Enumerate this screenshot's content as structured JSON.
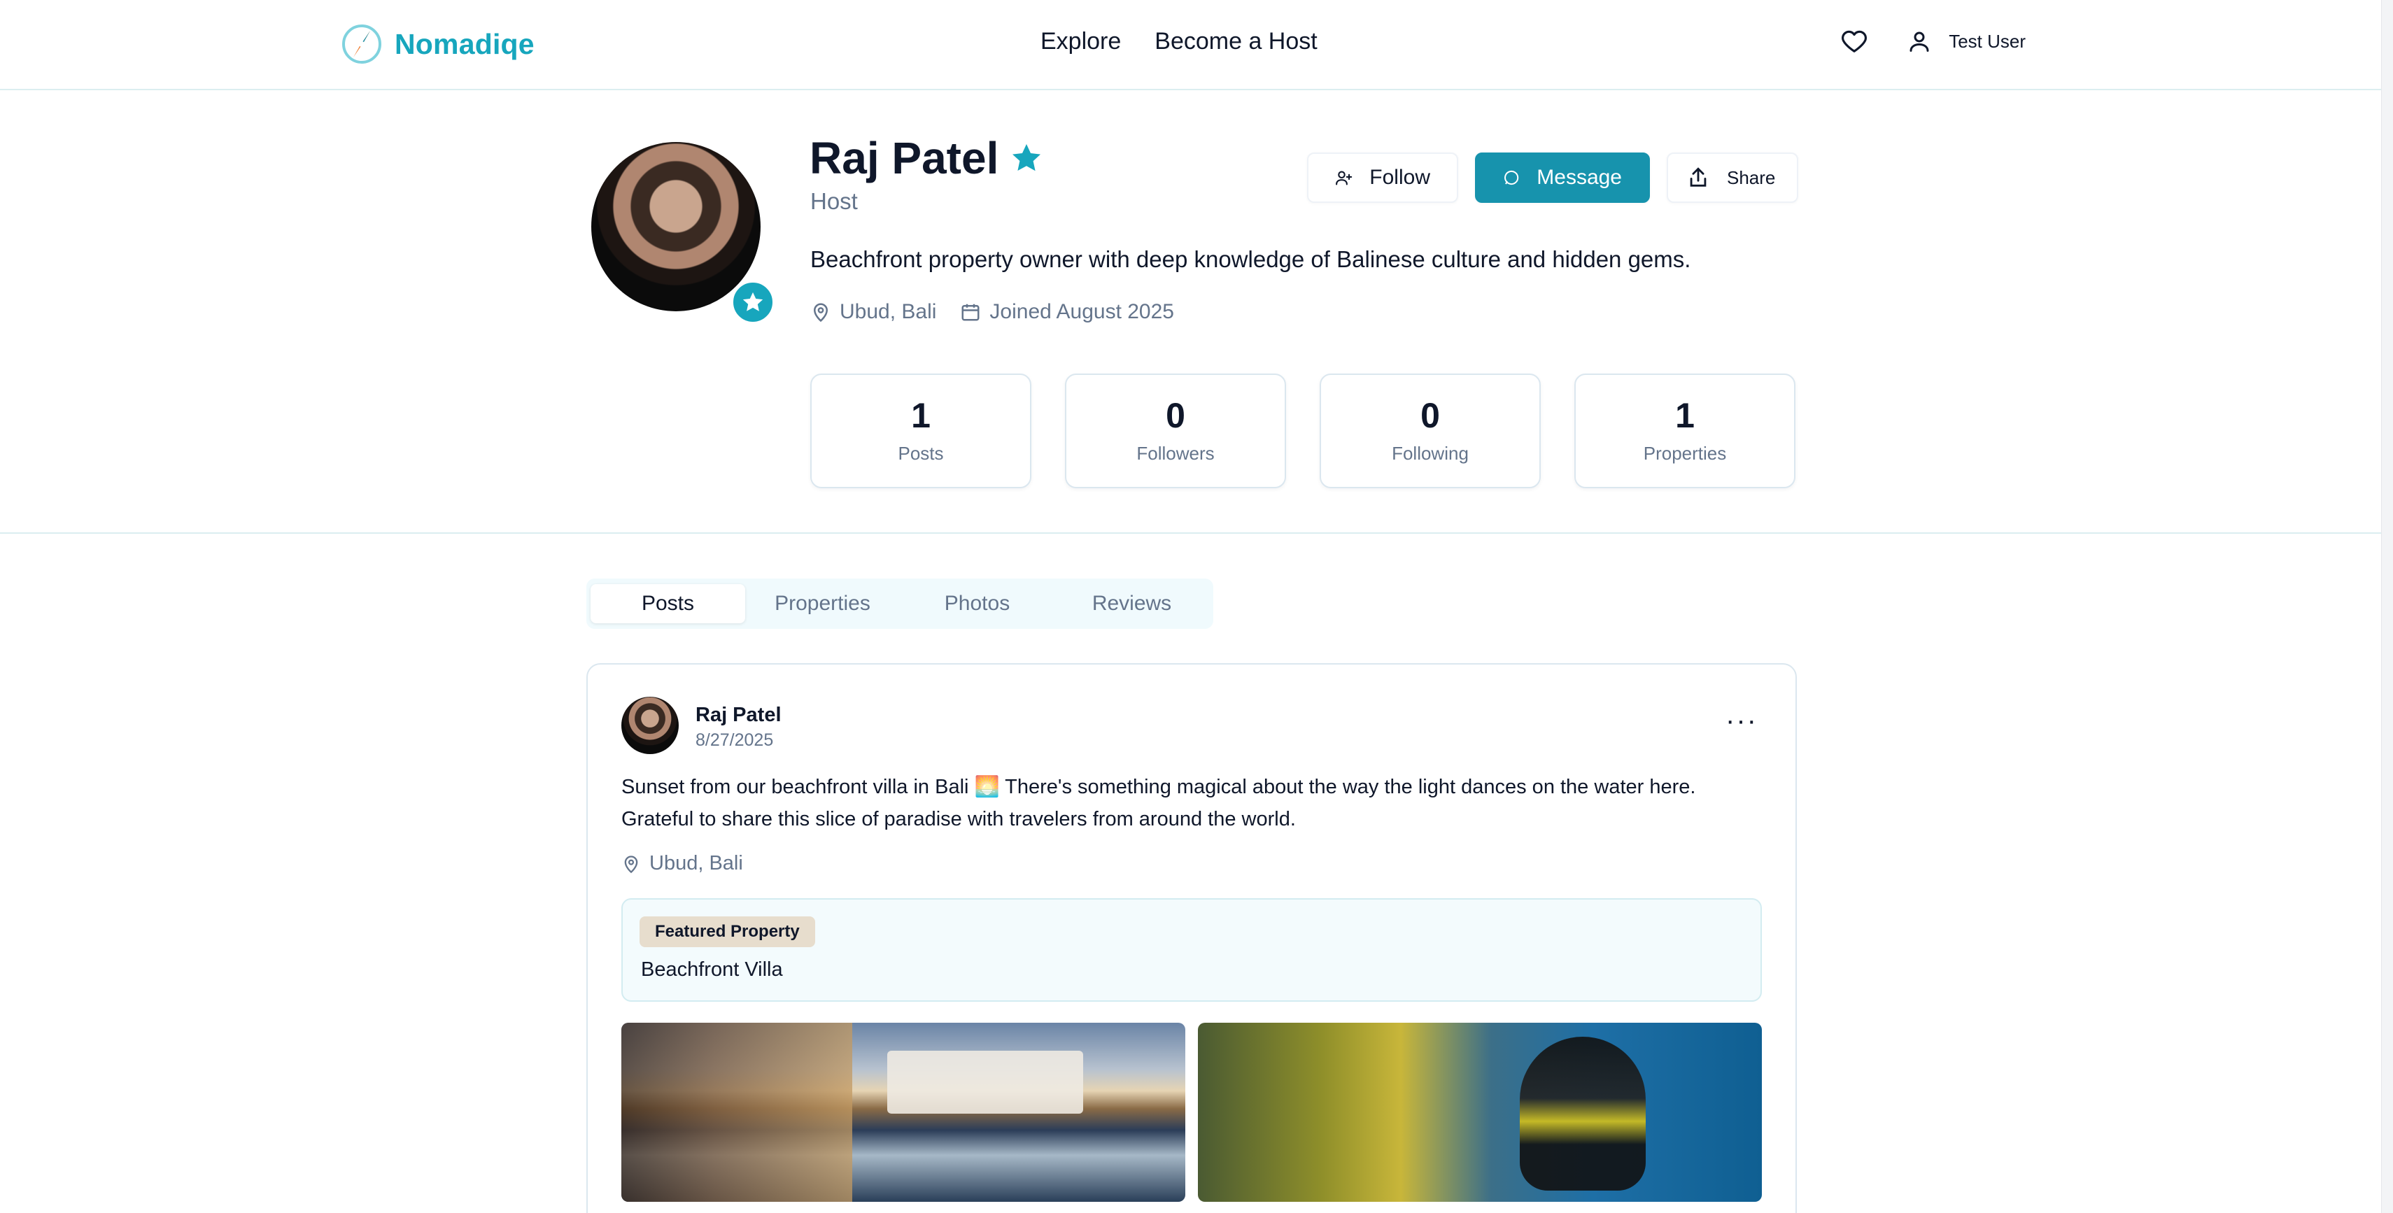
{
  "nav": {
    "brand": "Nomadiqe",
    "links": [
      "Explore",
      "Become a Host"
    ],
    "user": "Test User"
  },
  "profile": {
    "name": "Raj Patel",
    "role": "Host",
    "bio": "Beachfront property owner with deep knowledge of Balinese culture and hidden gems.",
    "location": "Ubud, Bali",
    "joined": "Joined August 2025",
    "actions": {
      "follow": "Follow",
      "message": "Message",
      "share": "Share"
    },
    "stats": [
      {
        "value": "1",
        "label": "Posts"
      },
      {
        "value": "0",
        "label": "Followers"
      },
      {
        "value": "0",
        "label": "Following"
      },
      {
        "value": "1",
        "label": "Properties"
      }
    ]
  },
  "tabs": [
    "Posts",
    "Properties",
    "Photos",
    "Reviews"
  ],
  "active_tab": "Posts",
  "post": {
    "author": "Raj Patel",
    "date": "8/27/2025",
    "menu": "···",
    "text": "Sunset from our beachfront villa in Bali 🌅 There's something magical about the way the light dances on the water here. Grateful to share this slice of paradise with travelers from around the world.",
    "location": "Ubud, Bali",
    "featured_badge": "Featured Property",
    "featured_name": "Beachfront Villa"
  },
  "colors": {
    "accent": "#17a6bd",
    "primary_button": "#1793ad",
    "muted": "#64748b"
  }
}
